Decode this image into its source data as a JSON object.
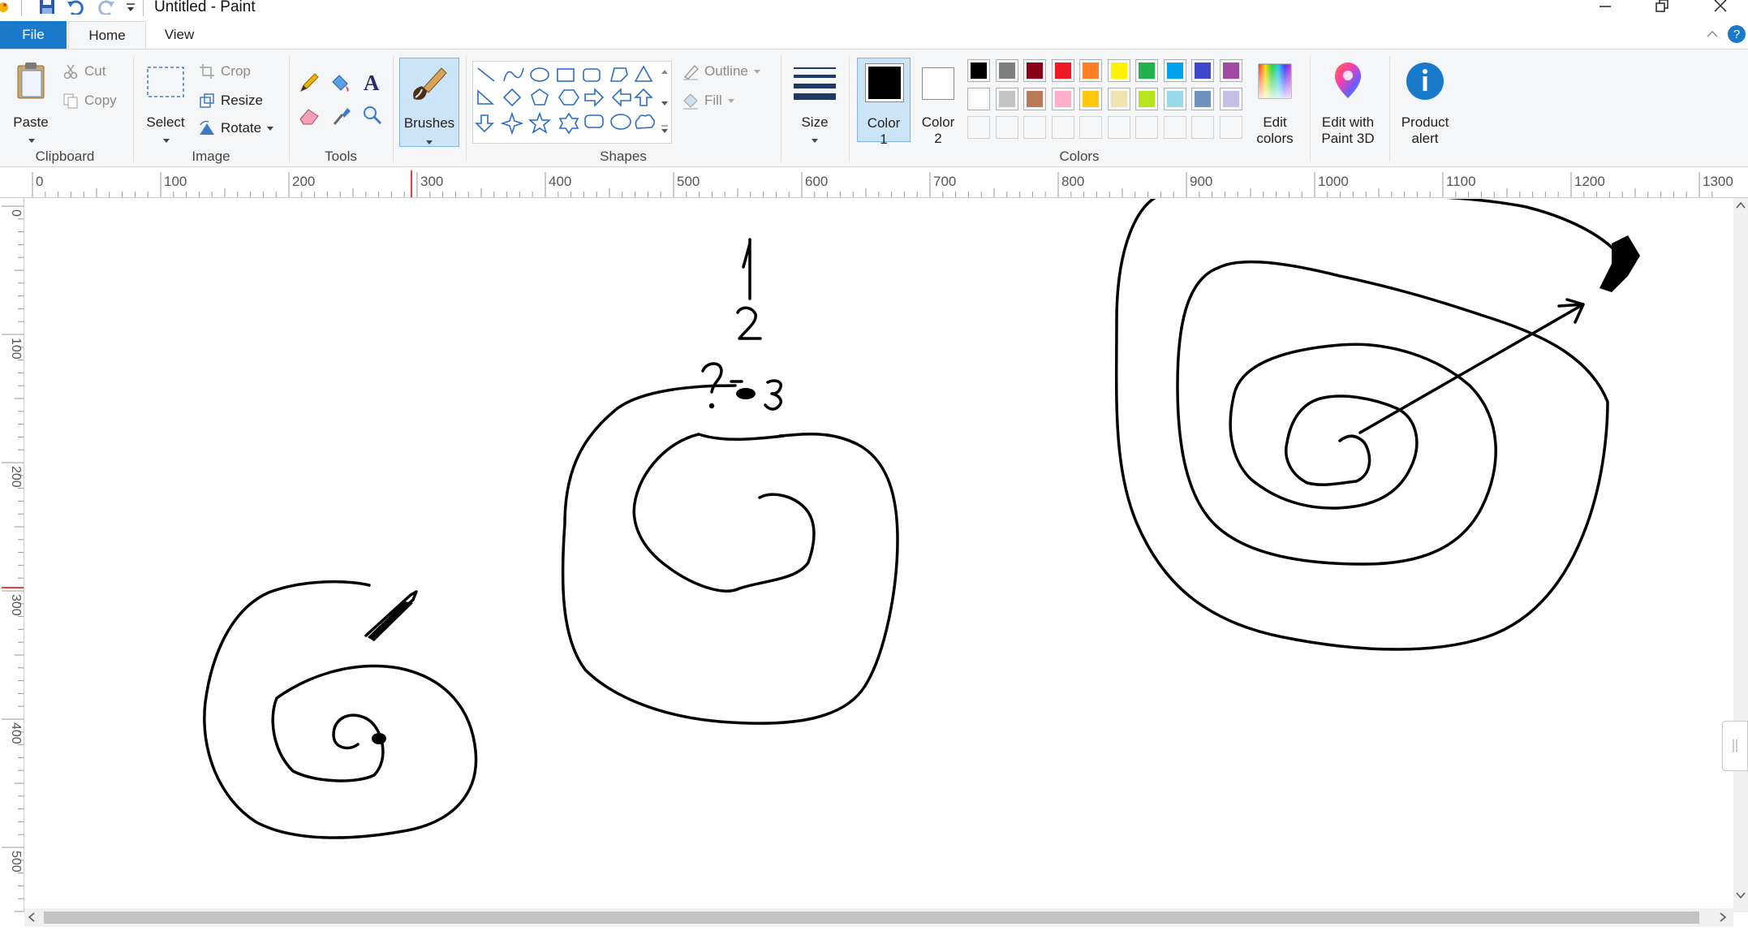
{
  "window": {
    "title": "Untitled - Paint"
  },
  "tabs": {
    "file": "File",
    "home": "Home",
    "view": "View"
  },
  "ribbon": {
    "clipboard": {
      "group_label": "Clipboard",
      "paste": "Paste",
      "cut": "Cut",
      "copy": "Copy"
    },
    "image": {
      "group_label": "Image",
      "select": "Select",
      "crop": "Crop",
      "resize": "Resize",
      "rotate": "Rotate"
    },
    "tools": {
      "group_label": "Tools",
      "icons": [
        "pencil-icon",
        "fill-bucket-icon",
        "text-icon",
        "eraser-icon",
        "color-picker-icon",
        "magnifier-icon"
      ]
    },
    "brushes": {
      "label": "Brushes"
    },
    "shapes": {
      "group_label": "Shapes",
      "outline": "Outline",
      "fill": "Fill",
      "icons": [
        "line",
        "curve",
        "oval",
        "rectangle",
        "rounded-rectangle",
        "polygon",
        "triangle",
        "right-triangle",
        "diamond",
        "pentagon",
        "hexagon",
        "right-arrow",
        "left-arrow",
        "up-arrow",
        "down-arrow",
        "four-point-star",
        "five-point-star",
        "six-point-star",
        "rounded-callout",
        "oval-callout",
        "cloud-callout"
      ]
    },
    "size": {
      "label": "Size"
    },
    "colors": {
      "group_label": "Colors",
      "color1_line1": "Color",
      "color1_line2": "1",
      "color2_line1": "Color",
      "color2_line2": "2",
      "color1_value": "#000000",
      "color2_value": "#ffffff",
      "edit_colors_line1": "Edit",
      "edit_colors_line2": "colors",
      "palette_row1": [
        "#000000",
        "#7f7f7f",
        "#880015",
        "#ed1c24",
        "#ff7f27",
        "#fff200",
        "#22b14c",
        "#00a2e8",
        "#3f48cc",
        "#a349a4"
      ],
      "palette_row2": [
        "#ffffff",
        "#c3c3c3",
        "#b97a57",
        "#ffaec9",
        "#ffc90e",
        "#efe4b0",
        "#b5e61d",
        "#99d9ea",
        "#7092be",
        "#c8bfe7"
      ],
      "palette_row3": [
        "",
        "",
        "",
        "",
        "",
        "",
        "",
        "",
        "",
        ""
      ]
    },
    "paint3d": {
      "line1": "Edit with",
      "line2": "Paint 3D"
    },
    "product_alert": {
      "line1": "Product",
      "line2": "alert"
    }
  },
  "ruler": {
    "h_labels": [
      "0",
      "100",
      "200",
      "300",
      "400",
      "500",
      "600",
      "700",
      "800",
      "900",
      "1000",
      "1100",
      "1200",
      "1300"
    ],
    "v_labels": [
      "0",
      "100",
      "200",
      "300",
      "400",
      "500"
    ]
  },
  "canvas": {
    "text_marks": [
      "1",
      "2",
      "3",
      "?"
    ]
  }
}
